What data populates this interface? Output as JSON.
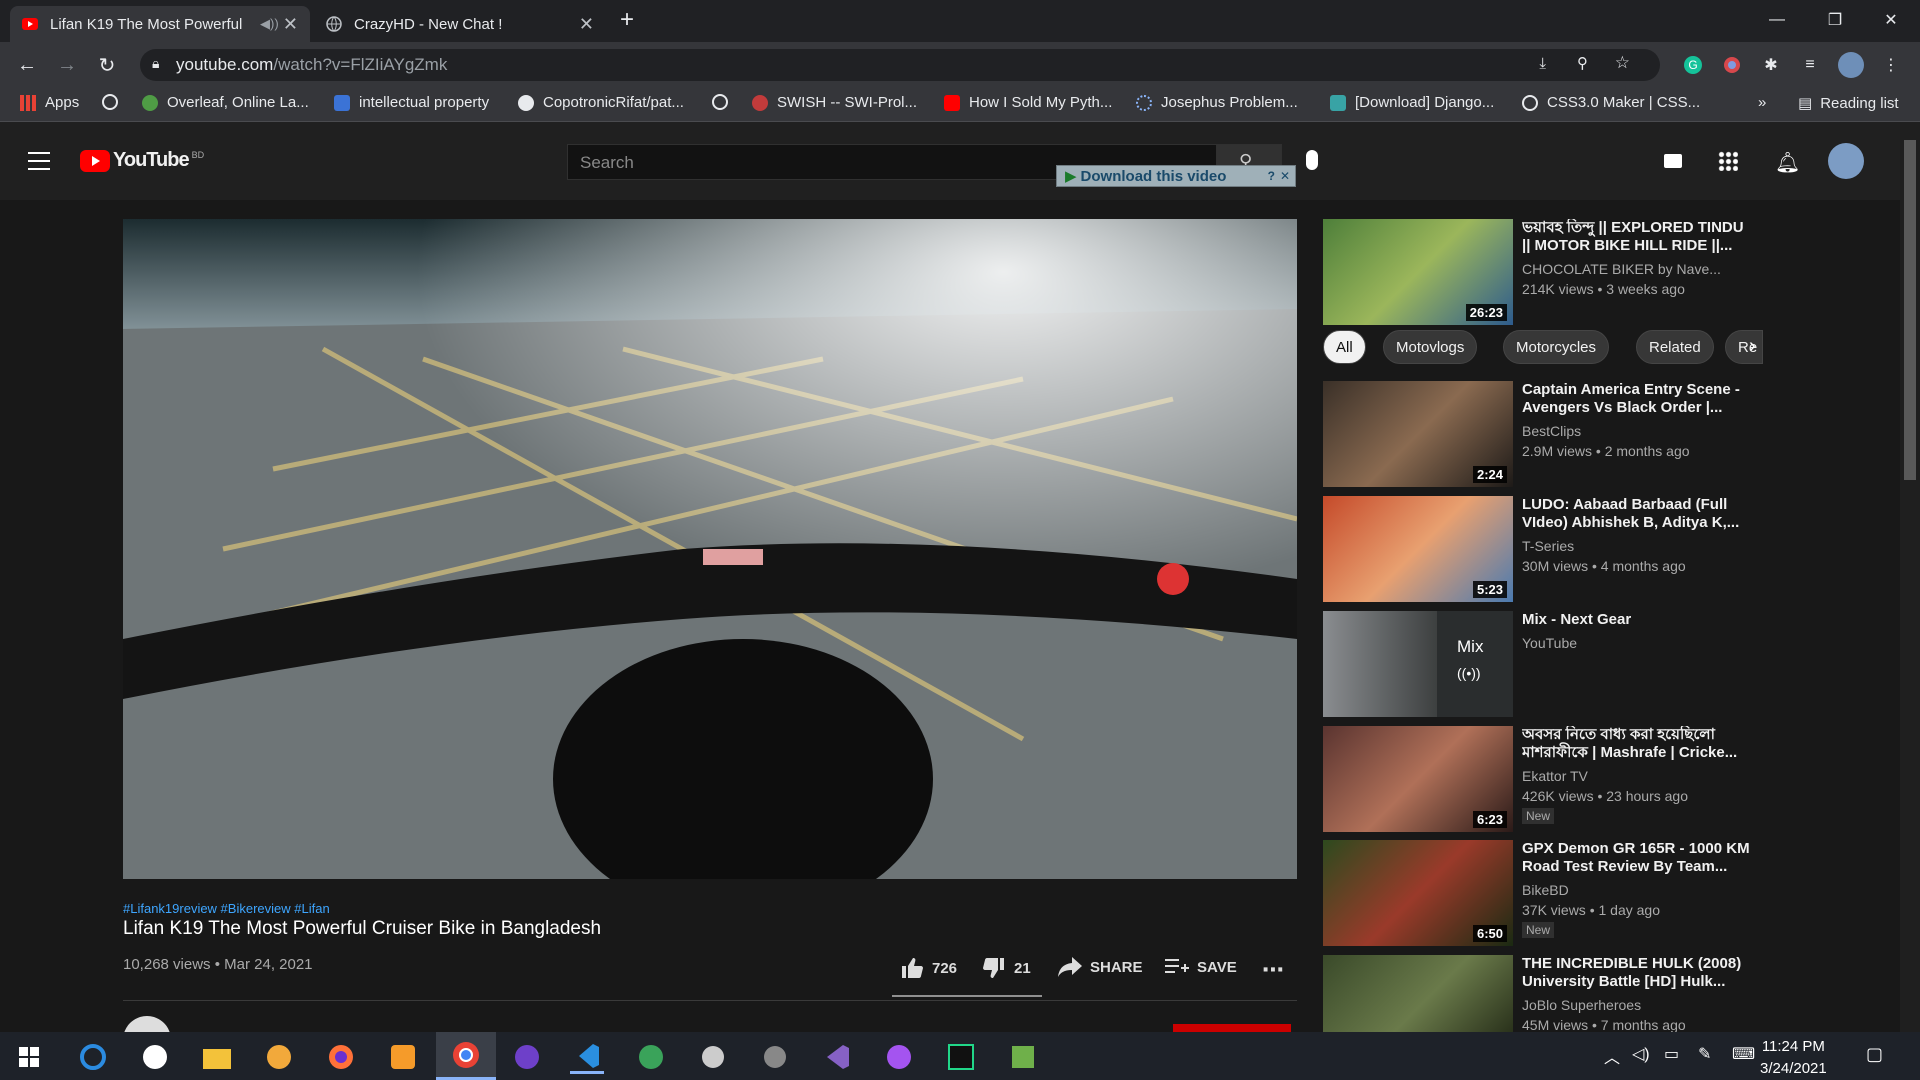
{
  "browser": {
    "tabs": [
      {
        "title": "Lifan K19 The Most Powerful"
      },
      {
        "title": "CrazyHD - New Chat !"
      }
    ],
    "url_host": "youtube.com",
    "url_path": "/watch?v=FlZIiAYgZmk",
    "bookmarks": [
      "Apps",
      "Overleaf, Online La...",
      "intellectual property",
      "CopotronicRifat/pat...",
      "SWISH -- SWI-Prol...",
      "How I Sold My Pyth...",
      "Josephus Problem...",
      "[Download] Django...",
      "CSS3.0 Maker | CSS..."
    ],
    "more_bookmarks": "»",
    "reading_list": "Reading list",
    "colors": {
      "tab_bar": "#202124",
      "toolbar": "#35363a"
    }
  },
  "youtube": {
    "logo_text": "YouTube",
    "logo_region": "BD",
    "search_placeholder": "Search",
    "download_banner": "Download this video",
    "video": {
      "hashtags": "#Lifank19review #Bikereview #Lifan",
      "title": "Lifan K19 The Most Powerful Cruiser Bike in Bangladesh",
      "meta": "10,268 views • Mar 24, 2021",
      "likes": "726",
      "dislikes": "21",
      "share_label": "SHARE",
      "save_label": "SAVE"
    },
    "chips": [
      "All",
      "Motovlogs",
      "Motorcycles",
      "Related",
      "Re"
    ],
    "recommendations": [
      {
        "title": "ভয়াবহ তিন্দু || EXPLORED TINDU || MOTOR BIKE HILL RIDE ||...",
        "channel": "CHOCOLATE BIKER by Nave...",
        "views": "214K views • 3 weeks ago",
        "duration": "26:23",
        "badge": ""
      },
      {
        "title": "Captain America Entry Scene - Avengers Vs Black Order |...",
        "channel": "BestClips",
        "views": "2.9M views • 2 months ago",
        "duration": "2:24",
        "badge": ""
      },
      {
        "title": "LUDO: Aabaad Barbaad (Full VIdeo) Abhishek B, Aditya K,...",
        "channel": "T-Series",
        "views": "30M views • 4 months ago",
        "duration": "5:23",
        "badge": ""
      },
      {
        "title": "Mix - Next Gear",
        "channel": "YouTube",
        "views": "",
        "duration": "",
        "badge": ""
      },
      {
        "title": "অবসর নিতে বাধ্য করা হয়েছিলো মাশরাফীকে | Mashrafe | Cricke...",
        "channel": "Ekattor TV",
        "views": "426K views • 23 hours ago",
        "duration": "6:23",
        "badge": "New"
      },
      {
        "title": "GPX Demon GR 165R - 1000 KM Road Test Review By Team...",
        "channel": "BikeBD",
        "views": "37K views • 1 day ago",
        "duration": "6:50",
        "badge": "New"
      },
      {
        "title": "THE INCREDIBLE HULK (2008) University Battle [HD] Hulk...",
        "channel": "JoBlo Superheroes",
        "views": "45M views • 7 months ago",
        "duration": "",
        "badge": ""
      }
    ],
    "mix_label": "Mix"
  },
  "taskbar": {
    "time": "11:24 PM",
    "date": "3/24/2021"
  }
}
